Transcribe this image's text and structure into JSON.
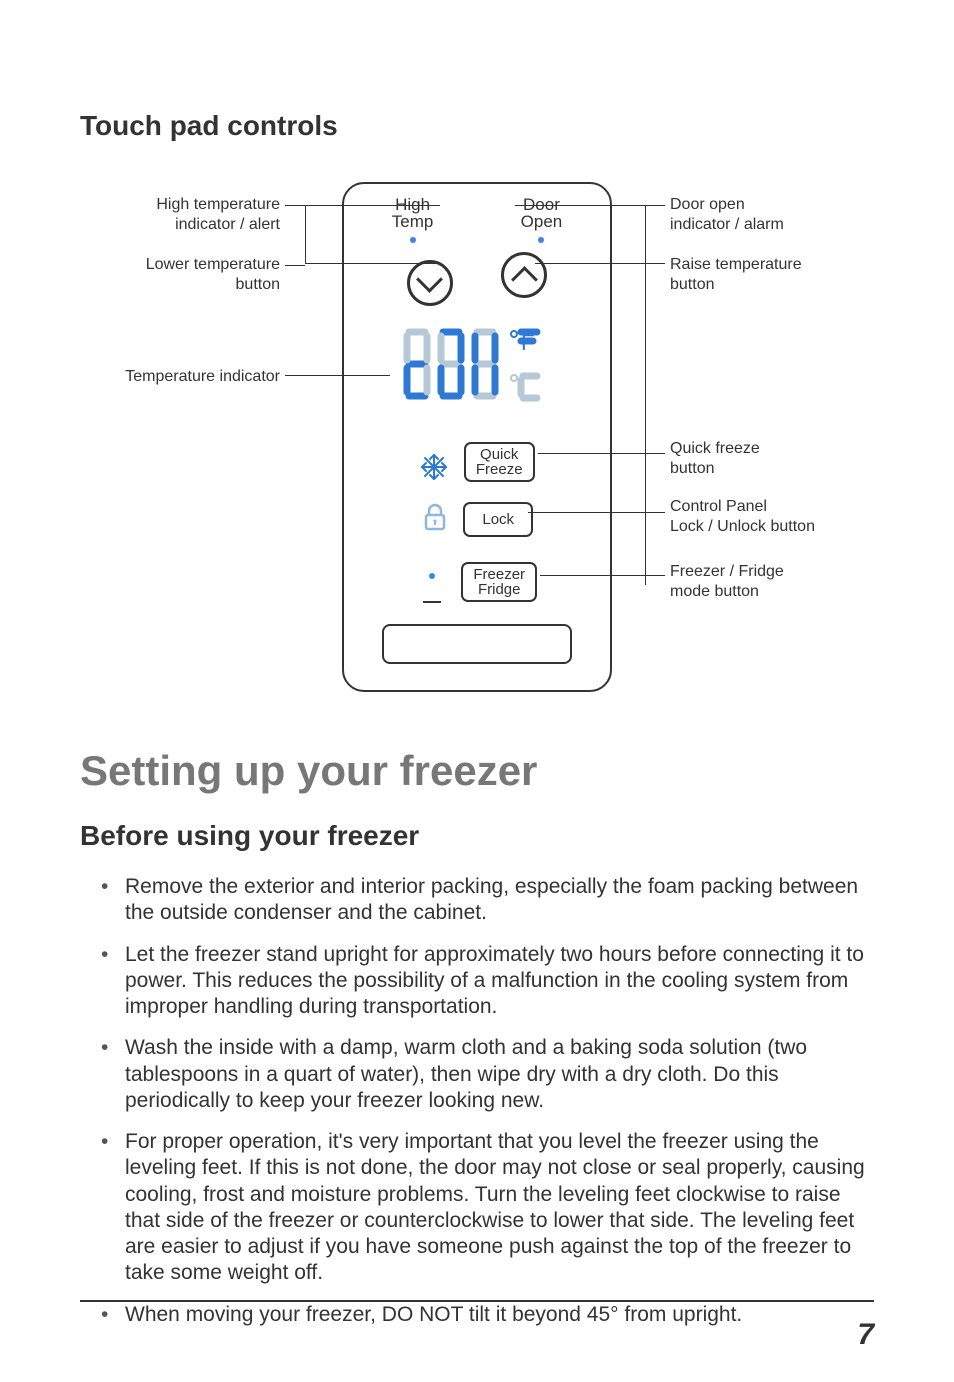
{
  "section_heading": "Touch pad controls",
  "main_heading": "Setting up your freezer",
  "sub_heading": "Before using your freezer",
  "bullets": [
    "Remove the exterior and interior packing, especially the foam packing between the outside condenser and the cabinet.",
    "Let the freezer stand upright for approximately two hours before connecting it to power. This reduces the possibility of a malfunction in the cooling system from improper handling during transportation.",
    "Wash the inside with a damp, warm cloth and a baking soda solution (two tablespoons in a quart of water), then wipe dry with a dry cloth. Do this periodically to keep your freezer looking new.",
    "For proper operation, it's very important that you level the freezer using the leveling feet. If this is not done, the door may not close or seal properly, causing cooling, frost and moisture problems. Turn the leveling feet clockwise to raise that side of the freezer or counterclockwise to lower that side. The leveling feet are easier to adjust if you have someone push against the top of the freezer to take some weight off.",
    "When moving your freezer, DO NOT tilt it beyond 45° from upright."
  ],
  "panel": {
    "high_temp_label_l1": "High",
    "high_temp_label_l2": "Temp",
    "door_open_label_l1": "Door",
    "door_open_label_l2": "Open",
    "quick_freeze_label_l1": "Quick",
    "quick_freeze_label_l2": "Freeze",
    "lock_label": "Lock",
    "freezer_fridge_label_l1": "Freezer",
    "freezer_fridge_label_l2": "Fridge",
    "f_unit": "F",
    "c_unit": "C"
  },
  "callouts": {
    "high_temp": "High temperature\nindicator / alert",
    "lower_temp": "Lower temperature\nbutton",
    "temp_indicator": "Temperature indicator",
    "door_open": "Door open\nindicator / alarm",
    "raise_temp": "Raise temperature\nbutton",
    "quick_freeze": "Quick freeze\nbutton",
    "control_lock": "Control Panel\nLock / Unlock button",
    "freezer_fridge": "Freezer / Fridge\nmode button"
  },
  "page_number": "7"
}
